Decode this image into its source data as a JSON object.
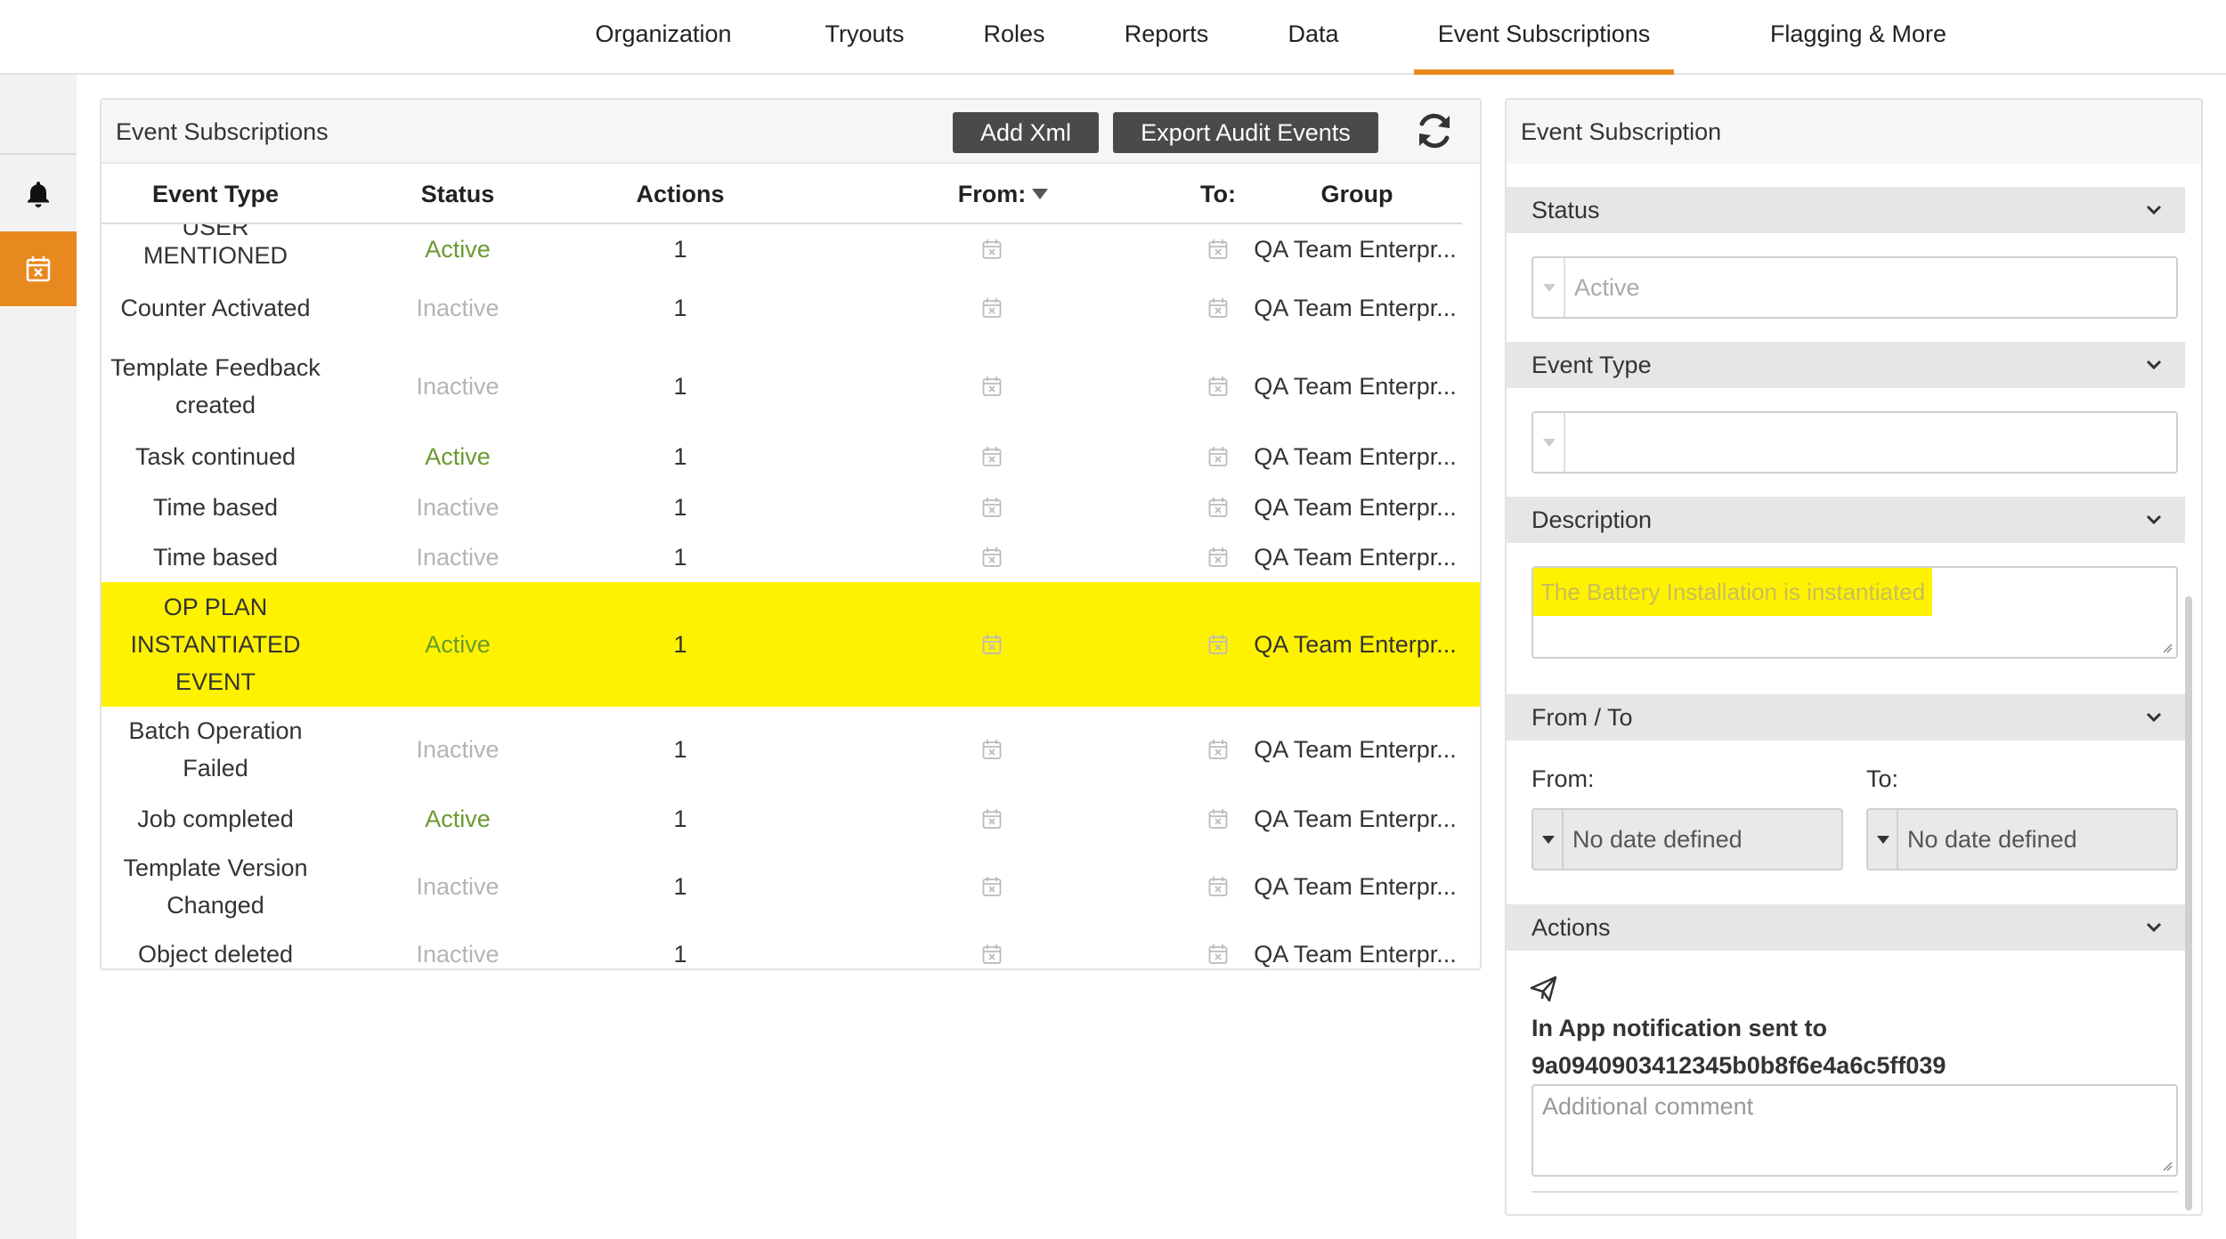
{
  "nav": {
    "tabs": [
      {
        "label": "Organization"
      },
      {
        "label": "Tryouts"
      },
      {
        "label": "Roles"
      },
      {
        "label": "Reports"
      },
      {
        "label": "Data"
      },
      {
        "label": "Event Subscriptions"
      },
      {
        "label": "Flagging & More"
      }
    ],
    "active_tab": "Event Subscriptions",
    "accent_color": "#e8891f"
  },
  "sidebar": {
    "items": [
      {
        "icon": "bell-icon"
      },
      {
        "icon": "calendar-x-icon",
        "active": true
      }
    ]
  },
  "list_panel": {
    "title": "Event Subscriptions",
    "add_xml_label": "Add Xml",
    "export_label": "Export Audit Events",
    "columns": {
      "event_type": "Event Type",
      "status": "Status",
      "actions": "Actions",
      "from": "From:",
      "to": "To:",
      "group": "Group"
    },
    "partial_row_label": "USER",
    "rows": [
      {
        "event_type": "MENTIONED",
        "status": "Active",
        "actions": "1",
        "group": "QA Team Enterpr..."
      },
      {
        "event_type": "Counter Activated",
        "status": "Inactive",
        "actions": "1",
        "group": "QA Team Enterpr..."
      },
      {
        "event_type": "Template Feedback created",
        "status": "Inactive",
        "actions": "1",
        "group": "QA Team Enterpr..."
      },
      {
        "event_type": "Task continued",
        "status": "Active",
        "actions": "1",
        "group": "QA Team Enterpr..."
      },
      {
        "event_type": "Time based",
        "status": "Inactive",
        "actions": "1",
        "group": "QA Team Enterpr..."
      },
      {
        "event_type": "Time based",
        "status": "Inactive",
        "actions": "1",
        "group": "QA Team Enterpr..."
      },
      {
        "event_type": "OP PLAN INSTANTIATED EVENT",
        "status": "Active",
        "actions": "1",
        "group": "QA Team Enterpr...",
        "highlighted": true
      },
      {
        "event_type": "Batch Operation Failed",
        "status": "Inactive",
        "actions": "1",
        "group": "QA Team Enterpr..."
      },
      {
        "event_type": "Job completed",
        "status": "Active",
        "actions": "1",
        "group": "QA Team Enterpr..."
      },
      {
        "event_type": "Template Version Changed",
        "status": "Inactive",
        "actions": "1",
        "group": "QA Team Enterpr..."
      },
      {
        "event_type": "Object deleted",
        "status": "Inactive",
        "actions": "1",
        "group": "QA Team Enterpr..."
      }
    ],
    "colors": {
      "active": "#6a9a2f",
      "inactive": "#b5b5b5",
      "highlight": "#fff200"
    }
  },
  "detail_panel": {
    "title": "Event Subscription",
    "sections": {
      "status": "Status",
      "event_type": "Event Type",
      "description": "Description",
      "from_to": "From / To",
      "actions": "Actions"
    },
    "status_value": "Active",
    "event_type_value": "",
    "description_value": "The Battery Installation is instantiated",
    "from_label": "From:",
    "to_label": "To:",
    "from_value": "No date defined",
    "to_value": "No date defined",
    "notification_line1": "In App notification sent to",
    "notification_line2": "9a0940903412345b0b8f6e4a6c5ff039",
    "comment_placeholder": "Additional comment"
  }
}
